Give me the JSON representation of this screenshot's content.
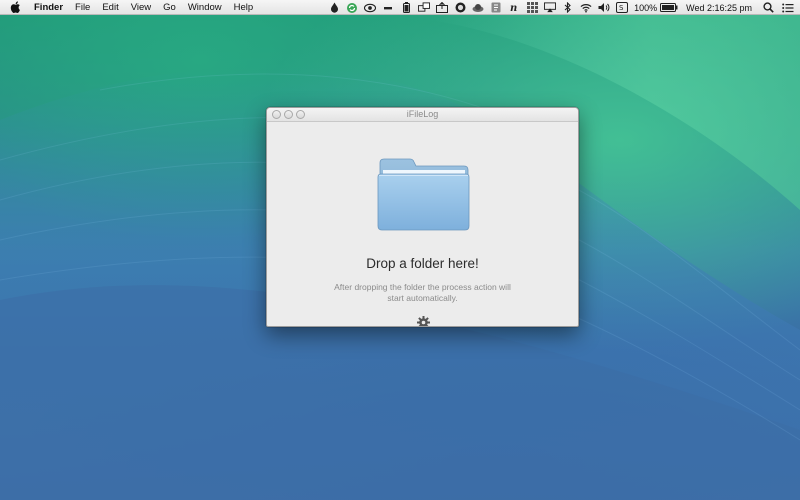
{
  "menubar": {
    "apple_icon": "apple-logo-icon",
    "app_name": "Finder",
    "menus": [
      "File",
      "Edit",
      "View",
      "Go",
      "Window",
      "Help"
    ],
    "battery": "100%",
    "clock": "Wed 2:16:25 pm"
  },
  "window": {
    "title": "iFileLog",
    "heading": "Drop a folder here!",
    "description_line1": "After dropping the folder the process action will",
    "description_line2": "start automatically.",
    "folder_icon": "folder-icon",
    "gear_icon": "gear-icon"
  },
  "colors": {
    "window_bg": "#ececec",
    "folder_blue": "#8fbbe0",
    "heading_text": "#2b2b2b",
    "description_text": "#8b8b8b"
  }
}
